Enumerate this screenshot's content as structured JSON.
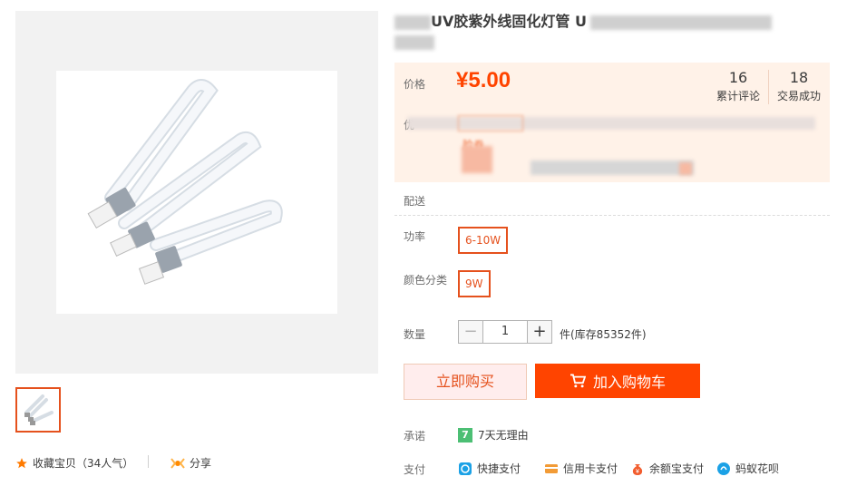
{
  "title": {
    "text": "UV胶紫外线固化灯管 U"
  },
  "price": {
    "label": "价格",
    "currency": "¥",
    "value": "5.00"
  },
  "stats": [
    {
      "num": "16",
      "label": "累计评论"
    },
    {
      "num": "18",
      "label": "交易成功"
    }
  ],
  "promo": {
    "prefix": "优",
    "tail": "脸券"
  },
  "delivery": {
    "label": "配送"
  },
  "power": {
    "label": "功率",
    "option": "6-10W"
  },
  "color": {
    "label": "颜色分类",
    "option": "9W"
  },
  "quantity": {
    "label": "数量",
    "value": "1",
    "minus": "−",
    "plus": "+",
    "stock": "件(库存85352件)"
  },
  "actions": {
    "buy_now": "立即购买",
    "add_cart": "加入购物车"
  },
  "promise": {
    "label": "承诺",
    "badge": "7",
    "text": "7天无理由"
  },
  "payment": {
    "label": "支付",
    "methods": [
      "快捷支付",
      "信用卡支付",
      "余额宝支付",
      "蚂蚁花呗"
    ]
  },
  "favorite": {
    "text": "收藏宝贝（34人气）"
  },
  "share": {
    "text": "分享"
  },
  "colors": {
    "accent": "#ff4400",
    "accent_border": "#e5511d"
  }
}
